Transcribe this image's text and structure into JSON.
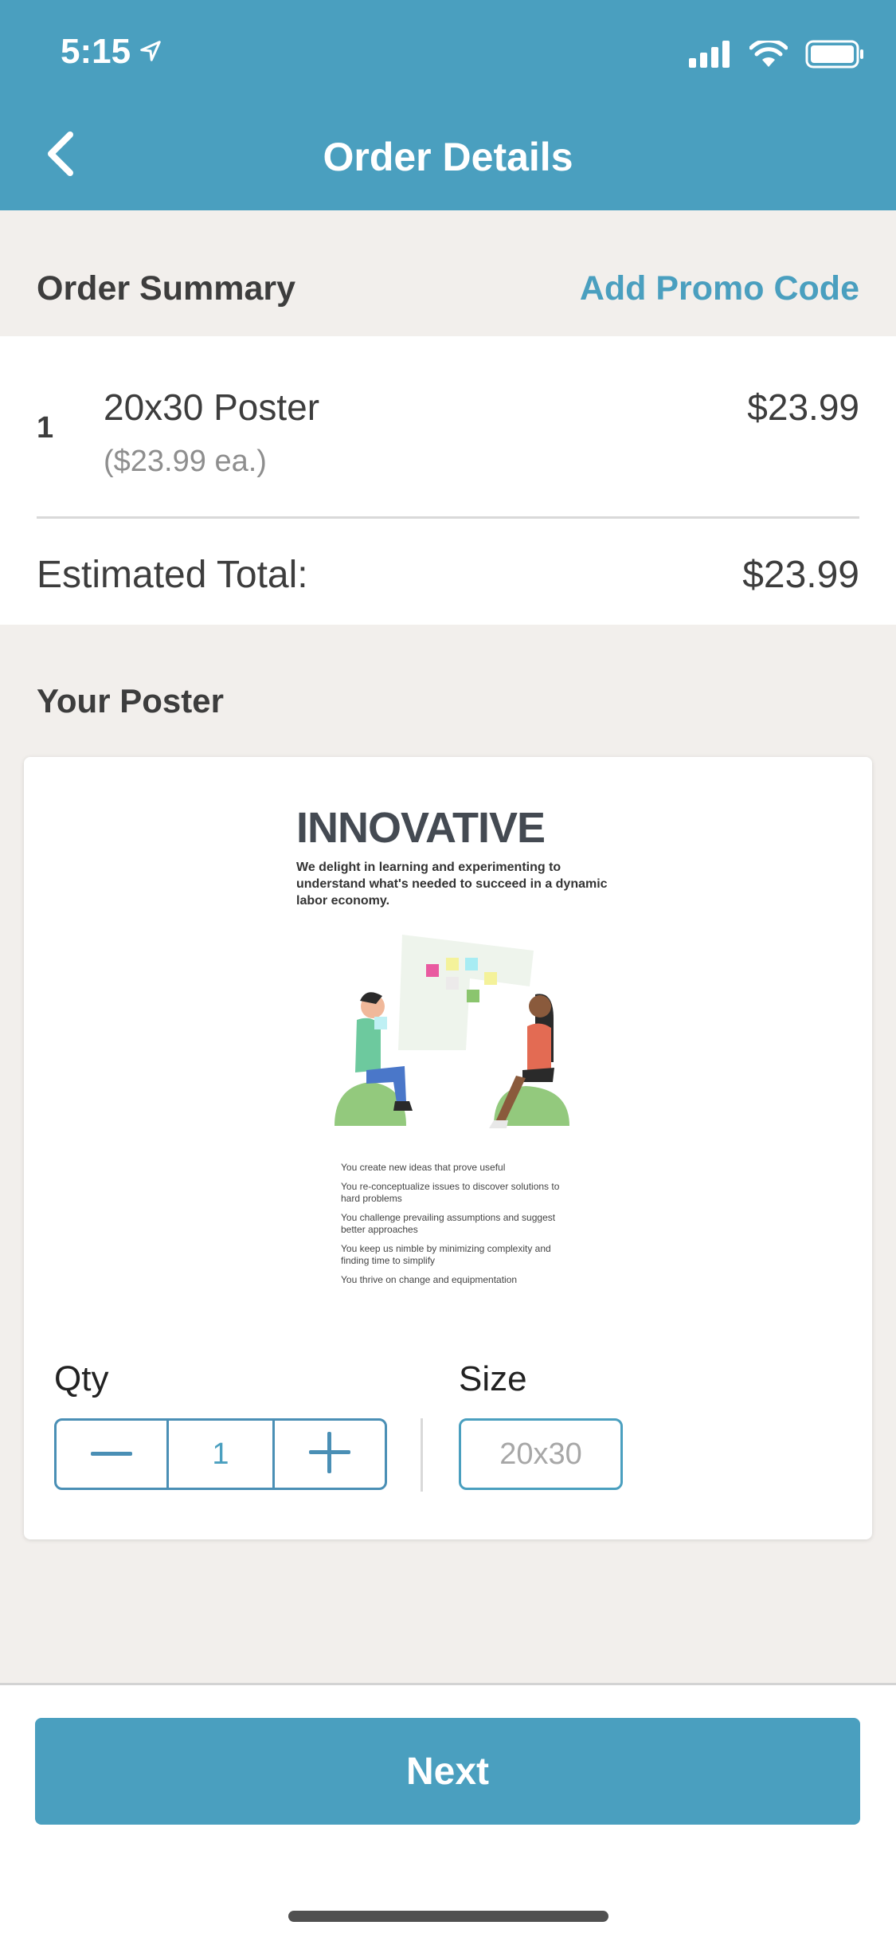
{
  "status_bar": {
    "time": "5:15"
  },
  "nav": {
    "title": "Order Details"
  },
  "order_summary": {
    "heading": "Order Summary",
    "promo_link": "Add Promo Code",
    "item": {
      "quantity": "1",
      "name": "20x30 Poster",
      "each_price": "($23.99 ea.)",
      "line_total": "$23.99"
    },
    "total_label": "Estimated Total:",
    "total_value": "$23.99"
  },
  "poster_section": {
    "heading": "Your Poster",
    "poster": {
      "title": "INNOVATIVE",
      "subtitle": "We delight in learning and experimenting to understand what's needed to succeed in a dynamic labor economy.",
      "bullets": [
        "You create new ideas that prove useful",
        "You re-conceptualize issues to discover solutions to hard problems",
        "You challenge prevailing assumptions and suggest better approaches",
        "You keep us nimble by minimizing complexity and finding time to simplify",
        "You thrive on change and equipmentation"
      ]
    },
    "qty_label": "Qty",
    "qty_value": "1",
    "size_label": "Size",
    "size_value": "20x30"
  },
  "footer": {
    "next_label": "Next"
  },
  "colors": {
    "accent": "#4a9fbf",
    "background": "#f2efec",
    "text": "#3d3d3d"
  }
}
